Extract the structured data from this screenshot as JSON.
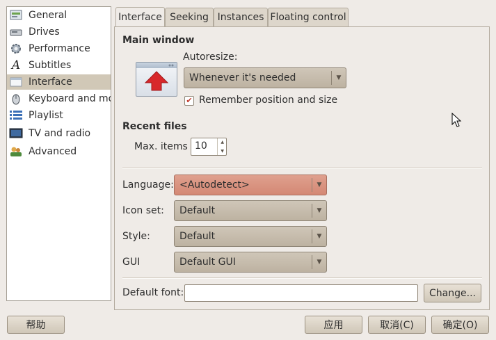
{
  "sidebar": {
    "items": [
      {
        "label": "General",
        "icon": "general-icon",
        "selected": false
      },
      {
        "label": "Drives",
        "icon": "drive-icon",
        "selected": false
      },
      {
        "label": "Performance",
        "icon": "performance-icon",
        "selected": false
      },
      {
        "label": "Subtitles",
        "icon": "subtitles-icon",
        "selected": false
      },
      {
        "label": "Interface",
        "icon": "interface-icon",
        "selected": true
      },
      {
        "label": "Keyboard and mouse",
        "icon": "keyboard-mouse-icon",
        "selected": false
      },
      {
        "label": "Playlist",
        "icon": "playlist-icon",
        "selected": false
      },
      {
        "label": "TV and radio",
        "icon": "tv-icon",
        "selected": false
      },
      {
        "label": "Advanced",
        "icon": "advanced-icon",
        "selected": false
      }
    ],
    "scroll_grip": "|||"
  },
  "tabs": [
    {
      "label": "Interface",
      "active": true
    },
    {
      "label": "Seeking",
      "active": false
    },
    {
      "label": "Instances",
      "active": false
    },
    {
      "label": "Floating control",
      "active": false
    }
  ],
  "main_window": {
    "title": "Main window",
    "autoresize_label": "Autoresize:",
    "autoresize_value": "Whenever it's needed",
    "remember_label": "Remember position and size",
    "remember_checked": true
  },
  "recent_files": {
    "title": "Recent files",
    "max_items_label": "Max. items",
    "max_items_value": "10"
  },
  "appearance": {
    "language_label": "Language:",
    "language_value": "<Autodetect>",
    "iconset_label": "Icon set:",
    "iconset_value": "Default",
    "style_label": "Style:",
    "style_value": "Default",
    "gui_label": "GUI",
    "gui_value": "Default GUI"
  },
  "font": {
    "label": "Default font:",
    "value": "",
    "change_button": "Change..."
  },
  "bottom_buttons": {
    "help": "帮助",
    "apply": "应用",
    "cancel": "取消(C)",
    "ok": "确定(O)"
  },
  "colors": {
    "accent_selected": "#d1c8b7",
    "language_highlight": "#d48874",
    "checkbox_mark": "#c0392b"
  }
}
